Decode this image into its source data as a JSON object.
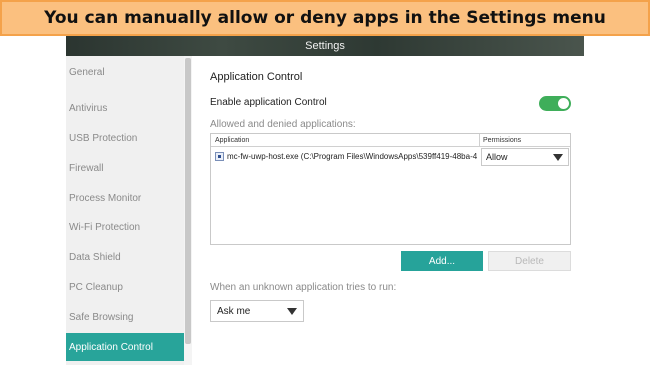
{
  "banner": {
    "text": "You can manually allow or deny apps in the Settings menu"
  },
  "window": {
    "title": "Settings"
  },
  "sidebar": {
    "items": [
      {
        "label": "General"
      },
      {
        "label": "Antivirus"
      },
      {
        "label": "USB Protection"
      },
      {
        "label": "Firewall"
      },
      {
        "label": "Process Monitor"
      },
      {
        "label": "Wi-Fi Protection"
      },
      {
        "label": "Data Shield"
      },
      {
        "label": "PC Cleanup"
      },
      {
        "label": "Safe Browsing"
      },
      {
        "label": "Application Control",
        "active": true
      }
    ]
  },
  "main": {
    "title": "Application Control",
    "enable_label": "Enable application Control",
    "enable_on": true,
    "list_caption": "Allowed and denied applications:",
    "table": {
      "columns": [
        "Application",
        "Permissions"
      ],
      "rows": [
        {
          "application": "mc-fw-uwp-host.exe (C:\\Program Files\\WindowsApps\\539ff419-48ba-4",
          "permission": "Allow",
          "checked": true
        }
      ]
    },
    "add_label": "Add...",
    "delete_label": "Delete",
    "unknown_label": "When an unknown application tries to run:",
    "unknown_value": "Ask me"
  },
  "colors": {
    "accent": "#26a39a",
    "toggle_on": "#3fae5a",
    "banner_bg": "#fbc07f",
    "banner_border": "#f4a24a"
  },
  "icons": {
    "row_checkbox": "checkbox-icon",
    "dropdown": "chevron-down-icon"
  }
}
